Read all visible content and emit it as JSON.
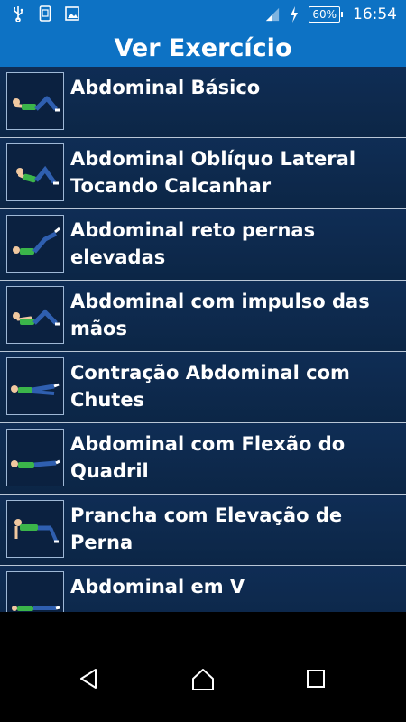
{
  "status_bar": {
    "icons": [
      "usb-icon",
      "screenshot-icon",
      "image-icon"
    ],
    "battery_percent": "60%",
    "time": "16:54"
  },
  "header": {
    "title": "Ver Exercício"
  },
  "exercises": [
    {
      "name": "Abdominal Básico",
      "pose": "crunch"
    },
    {
      "name": "Abdominal Oblíquo Lateral Tocando Calcanhar",
      "pose": "oblique"
    },
    {
      "name": "Abdominal reto pernas elevadas",
      "pose": "legs-raised"
    },
    {
      "name": "Abdominal com impulso das mãos",
      "pose": "hand-push"
    },
    {
      "name": "Contração Abdominal com Chutes",
      "pose": "kicks"
    },
    {
      "name": "Abdominal com Flexão do Quadril",
      "pose": "hip-flex"
    },
    {
      "name": "Prancha com Elevação de Perna",
      "pose": "plank"
    },
    {
      "name": "Abdominal em V",
      "pose": "v-sit"
    }
  ],
  "nav": {
    "buttons": [
      "back-icon",
      "home-icon",
      "recents-icon"
    ]
  }
}
